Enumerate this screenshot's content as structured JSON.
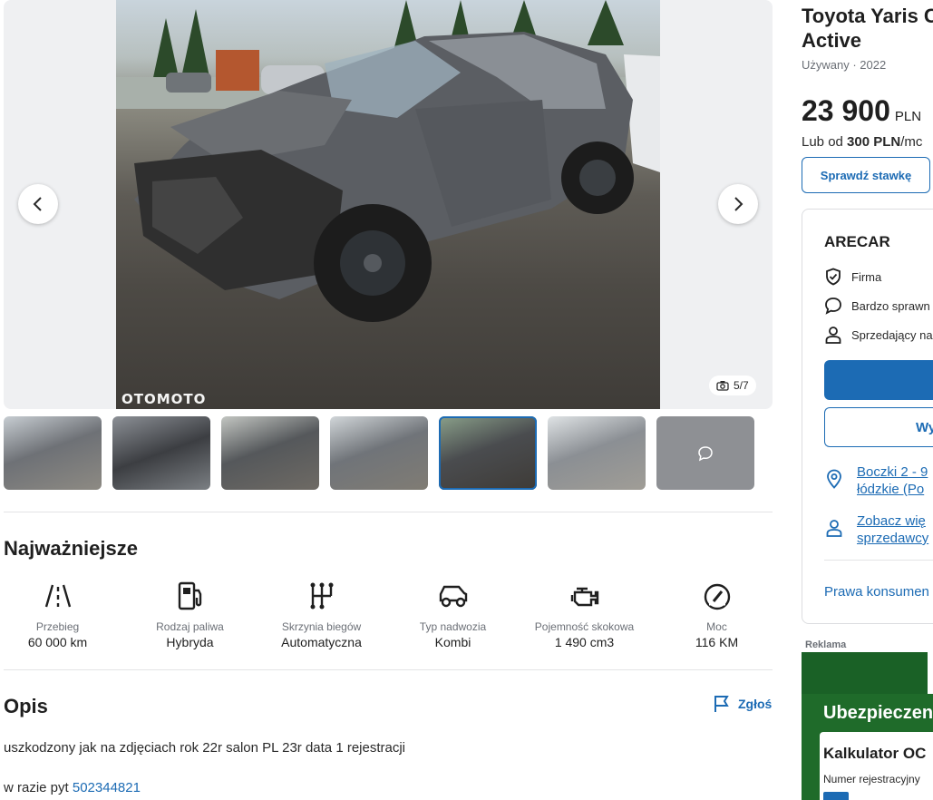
{
  "listing": {
    "title_line1": "Toyota Yaris C",
    "title_line2": "Active",
    "meta": "Używany · 2022",
    "price_amount": "23 900",
    "price_currency": "PLN",
    "finance_prefix": "Lub od ",
    "finance_amount": "300 PLN",
    "finance_suffix": "/mc",
    "rate_button": "Sprawdź stawkę"
  },
  "gallery": {
    "watermark": "OTOMOTO",
    "counter": "5/7",
    "thumbnail_count": 7
  },
  "highlights": {
    "heading": "Najważniejsze",
    "items": [
      {
        "label": "Przebieg",
        "value": "60 000 km",
        "icon": "road-icon"
      },
      {
        "label": "Rodzaj paliwa",
        "value": "Hybryda",
        "icon": "fuel-pump-icon"
      },
      {
        "label": "Skrzynia biegów",
        "value": "Automatyczna",
        "icon": "gearbox-icon"
      },
      {
        "label": "Typ nadwozia",
        "value": "Kombi",
        "icon": "car-body-icon"
      },
      {
        "label": "Pojemność skokowa",
        "value": "1 490 cm3",
        "icon": "engine-icon"
      },
      {
        "label": "Moc",
        "value": "116 KM",
        "icon": "speedometer-icon"
      }
    ]
  },
  "description": {
    "heading": "Opis",
    "report_label": "Zgłoś",
    "line1": "uszkodzony jak na zdjęciach  rok 22r salon PL 23r data 1 rejestracji",
    "line2_prefix": "w razie pyt ",
    "phone": "502344821"
  },
  "seller": {
    "name": "ARECAR",
    "rows": [
      "Firma",
      "Bardzo sprawn",
      "Sprzedający na"
    ],
    "secondary_button": "Wy",
    "address_line1": "Boczki 2 - 9",
    "address_line2": "łódzkie (Po",
    "offers_line1": "Zobacz wię",
    "offers_line2": "sprzedawcy",
    "consumer_link": "Prawa konsumen"
  },
  "ad": {
    "label": "Reklama",
    "headline": "Ubezpieczen",
    "box_title": "Kalkulator OC",
    "box_field": "Numer rejestracyjny"
  },
  "colors": {
    "accent": "#1c6bb4",
    "ad_green": "#1f6b2a"
  }
}
